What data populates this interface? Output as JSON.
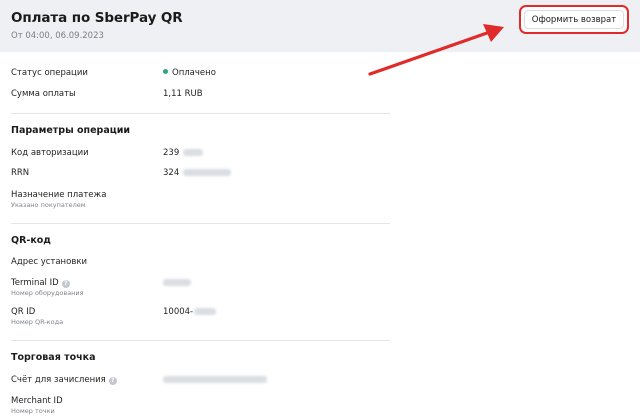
{
  "header": {
    "title": "Оплата по SberPay QR",
    "subtitle": "От 04:00, 06.09.2023",
    "refund_button_label": "Оформить возврат",
    "accent_color": "#e12b2b"
  },
  "summary": {
    "status_label": "Статус операции",
    "status_value": "Оплачено",
    "status_color": "#2fa37f",
    "amount_label": "Сумма оплаты",
    "amount_value": "1,11 RUB"
  },
  "operation_params": {
    "title": "Параметры операции",
    "auth_code_label": "Код авторизации",
    "auth_code_value": "239",
    "rrn_label": "RRN",
    "rrn_value": "324",
    "purpose_label": "Назначение платежа",
    "purpose_sub": "Указано покупателем"
  },
  "qr_code": {
    "title": "QR-код",
    "address_label": "Адрес установки",
    "terminal_label": "Terminal ID",
    "terminal_sub": "Номер оборудования",
    "qr_id_label": "QR ID",
    "qr_id_sub": "Номер QR-кода",
    "qr_id_value": "10004-"
  },
  "merchant": {
    "title": "Торговая точка",
    "account_label": "Счёт для зачисления",
    "merchant_id_label": "Merchant ID",
    "merchant_id_sub": "Номер точки"
  },
  "icons": {
    "info": "info-icon",
    "status": "status-dot-icon",
    "arrow": "red-arrow-annotation"
  }
}
